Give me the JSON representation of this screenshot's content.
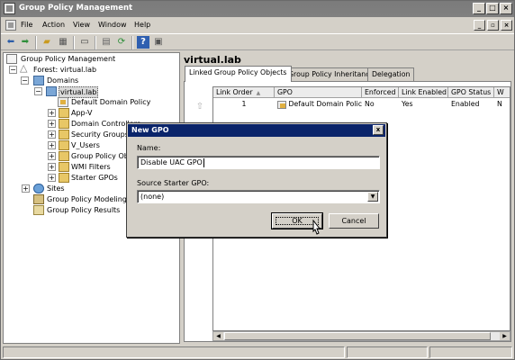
{
  "window": {
    "title": "Group Policy Management"
  },
  "menu": {
    "items": [
      "File",
      "Action",
      "View",
      "Window",
      "Help"
    ]
  },
  "tree": {
    "root": "Group Policy Management",
    "forest": "Forest: virtual.lab",
    "domains": "Domains",
    "domain": "virtual.lab",
    "children": [
      "Default Domain Policy",
      "App-V",
      "Domain Controllers",
      "Security Groups",
      "V_Users",
      "Group Policy Obje",
      "WMI Filters",
      "Starter GPOs"
    ],
    "sites": "Sites",
    "modeling": "Group Policy Modeling",
    "results": "Group Policy Results"
  },
  "right_pane": {
    "title": "virtual.lab",
    "tabs": [
      "Linked Group Policy Objects",
      "Group Policy Inheritance",
      "Delegation"
    ],
    "columns": [
      "Link Order",
      "GPO",
      "Enforced",
      "Link Enabled",
      "GPO Status",
      "W"
    ],
    "rows": [
      {
        "link_order": "1",
        "gpo": "Default Domain Policy",
        "enforced": "No",
        "link_enabled": "Yes",
        "gpo_status": "Enabled",
        "w": "N"
      }
    ]
  },
  "dialog": {
    "title": "New GPO",
    "close_label": "x",
    "name_label": "Name:",
    "name_value": "Disable UAC GPO",
    "starter_label": "Source Starter GPO:",
    "starter_value": "(none)",
    "ok_label": "OK",
    "cancel_label": "Cancel"
  },
  "colors": {
    "dialog_titlebar": "#0a246a",
    "window_titlebar": "#808080",
    "face": "#d4d0c8"
  },
  "icons": [
    "app-icon",
    "back-arrow-icon",
    "forward-arrow-icon",
    "up-folder-icon",
    "show-hide-tree-icon",
    "properties-icon",
    "export-list-icon",
    "refresh-icon",
    "help-icon",
    "console-icon",
    "forest-icon",
    "domain-icon",
    "gpo-icon",
    "folder-icon",
    "sites-icon",
    "modeling-icon",
    "results-icon",
    "mouse-cursor-icon"
  ]
}
